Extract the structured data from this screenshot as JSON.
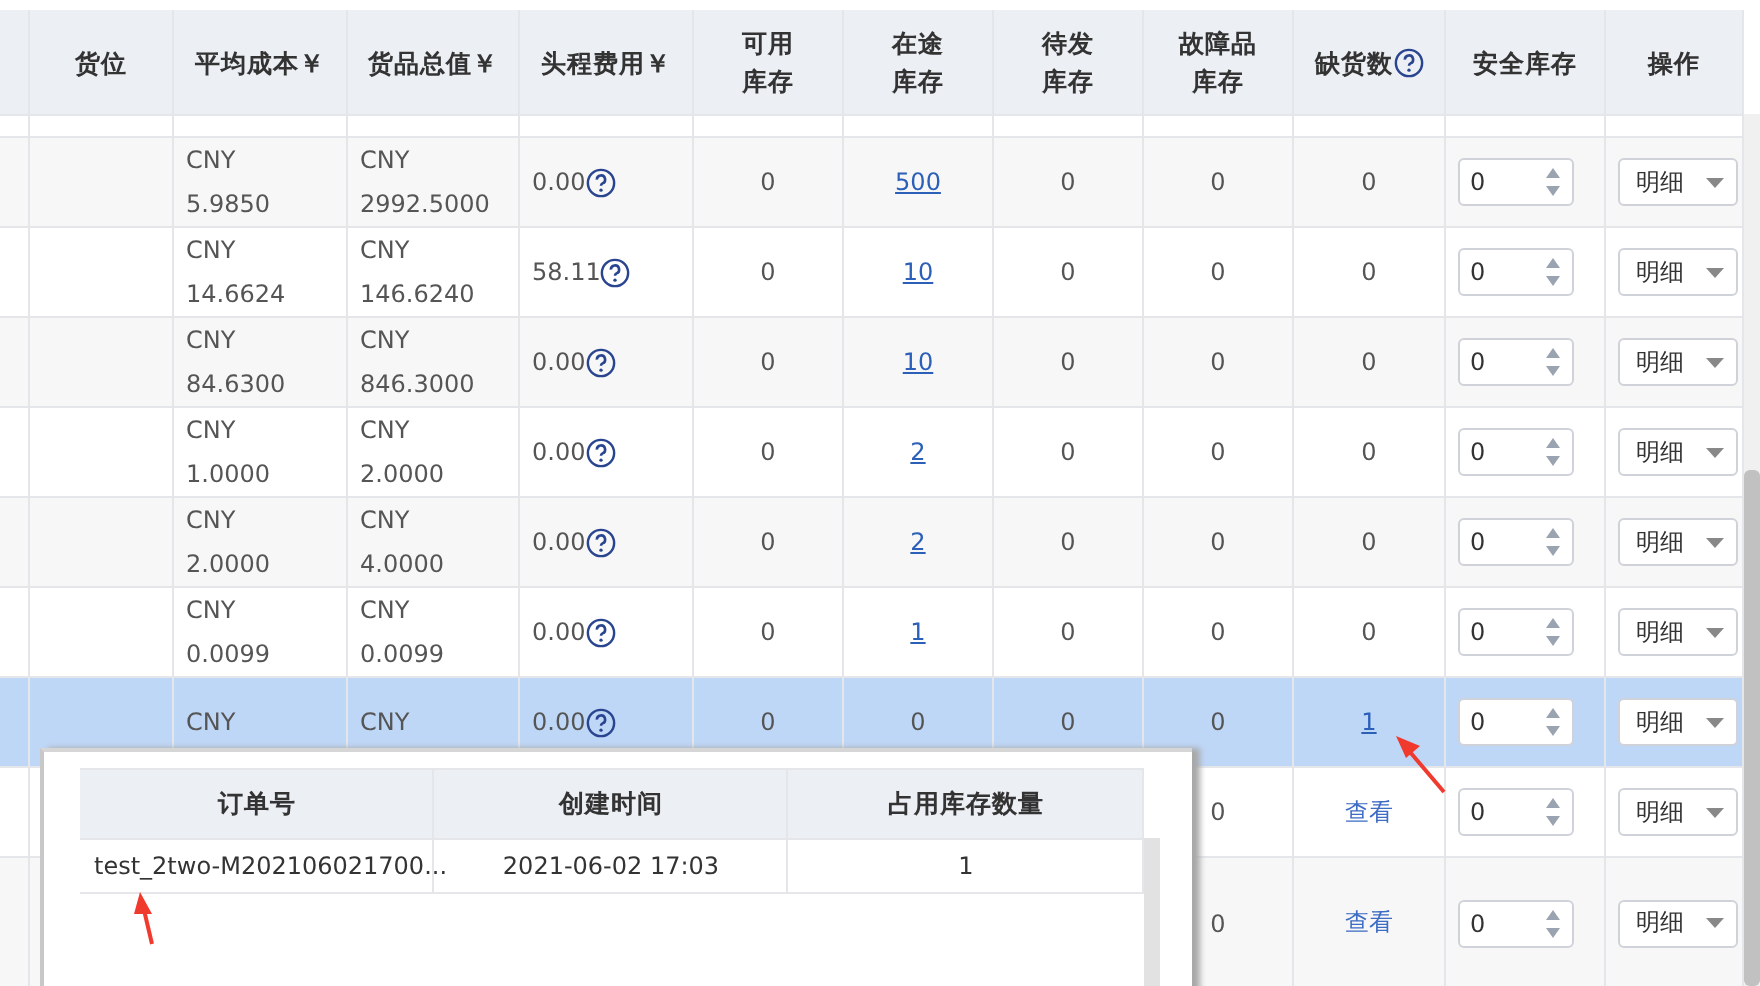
{
  "table": {
    "columns": [
      {
        "kind": "cut"
      },
      {
        "kind": "text",
        "lines": [
          "货位"
        ]
      },
      {
        "kind": "text",
        "lines": [
          "平均成本￥"
        ]
      },
      {
        "kind": "text",
        "lines": [
          "货品总值￥"
        ]
      },
      {
        "kind": "text",
        "lines": [
          "头程费用￥"
        ]
      },
      {
        "kind": "text",
        "lines": [
          "可用",
          "库存"
        ]
      },
      {
        "kind": "text",
        "lines": [
          "在途",
          "库存"
        ]
      },
      {
        "kind": "text",
        "lines": [
          "待发",
          "库存"
        ]
      },
      {
        "kind": "text",
        "lines": [
          "故障品",
          "库存"
        ]
      },
      {
        "kind": "help",
        "lines": [
          "缺货数"
        ]
      },
      {
        "kind": "text",
        "lines": [
          "安全库存"
        ]
      },
      {
        "kind": "text",
        "lines": [
          "操作"
        ]
      }
    ],
    "rows": [
      {
        "selected": false,
        "cost": [
          "CNY",
          "5.9850"
        ],
        "value": [
          "CNY",
          "2992.5000"
        ],
        "fee": "0.00",
        "available": "0",
        "in_transit": "500",
        "pending": "0",
        "faulty": "0",
        "shortage": {
          "kind": "number",
          "text": "0"
        },
        "safety": "0",
        "action": "明细"
      },
      {
        "selected": false,
        "cost": [
          "CNY",
          "14.6624"
        ],
        "value": [
          "CNY",
          "146.6240"
        ],
        "fee": "58.11",
        "available": "0",
        "in_transit": "10",
        "pending": "0",
        "faulty": "0",
        "shortage": {
          "kind": "number",
          "text": "0"
        },
        "safety": "0",
        "action": "明细"
      },
      {
        "selected": false,
        "cost": [
          "CNY",
          "84.6300"
        ],
        "value": [
          "CNY",
          "846.3000"
        ],
        "fee": "0.00",
        "available": "0",
        "in_transit": "10",
        "pending": "0",
        "faulty": "0",
        "shortage": {
          "kind": "number",
          "text": "0"
        },
        "safety": "0",
        "action": "明细"
      },
      {
        "selected": false,
        "cost": [
          "CNY",
          "1.0000"
        ],
        "value": [
          "CNY",
          "2.0000"
        ],
        "fee": "0.00",
        "available": "0",
        "in_transit": "2",
        "pending": "0",
        "faulty": "0",
        "shortage": {
          "kind": "number",
          "text": "0"
        },
        "safety": "0",
        "action": "明细"
      },
      {
        "selected": false,
        "cost": [
          "CNY",
          "2.0000"
        ],
        "value": [
          "CNY",
          "4.0000"
        ],
        "fee": "0.00",
        "available": "0",
        "in_transit": "2",
        "pending": "0",
        "faulty": "0",
        "shortage": {
          "kind": "number",
          "text": "0"
        },
        "safety": "0",
        "action": "明细"
      },
      {
        "selected": false,
        "cost": [
          "CNY",
          "0.0099"
        ],
        "value": [
          "CNY",
          "0.0099"
        ],
        "fee": "0.00",
        "available": "0",
        "in_transit": "1",
        "pending": "0",
        "faulty": "0",
        "shortage": {
          "kind": "number",
          "text": "0"
        },
        "safety": "0",
        "action": "明细"
      },
      {
        "selected": true,
        "cost": [
          "CNY"
        ],
        "value": [
          "CNY"
        ],
        "fee": "0.00",
        "available": "0",
        "in_transit": "0",
        "pending": "0",
        "faulty": "0",
        "shortage": {
          "kind": "link",
          "text": "1"
        },
        "safety": "0",
        "action": "明细"
      },
      {
        "selected": false,
        "faulty": "0",
        "shortage": {
          "kind": "link",
          "text": "查看"
        },
        "safety": "0",
        "action": "明细"
      },
      {
        "selected": false,
        "faulty": "0",
        "shortage": {
          "kind": "link",
          "text": "查看"
        },
        "safety": "0",
        "action": "明细"
      }
    ]
  },
  "popup": {
    "columns": [
      "订单号",
      "创建时间",
      "占用库存数量"
    ],
    "rows": [
      [
        "test_2two-M202106021700...",
        "2021-06-02 17:03",
        "1"
      ]
    ]
  }
}
